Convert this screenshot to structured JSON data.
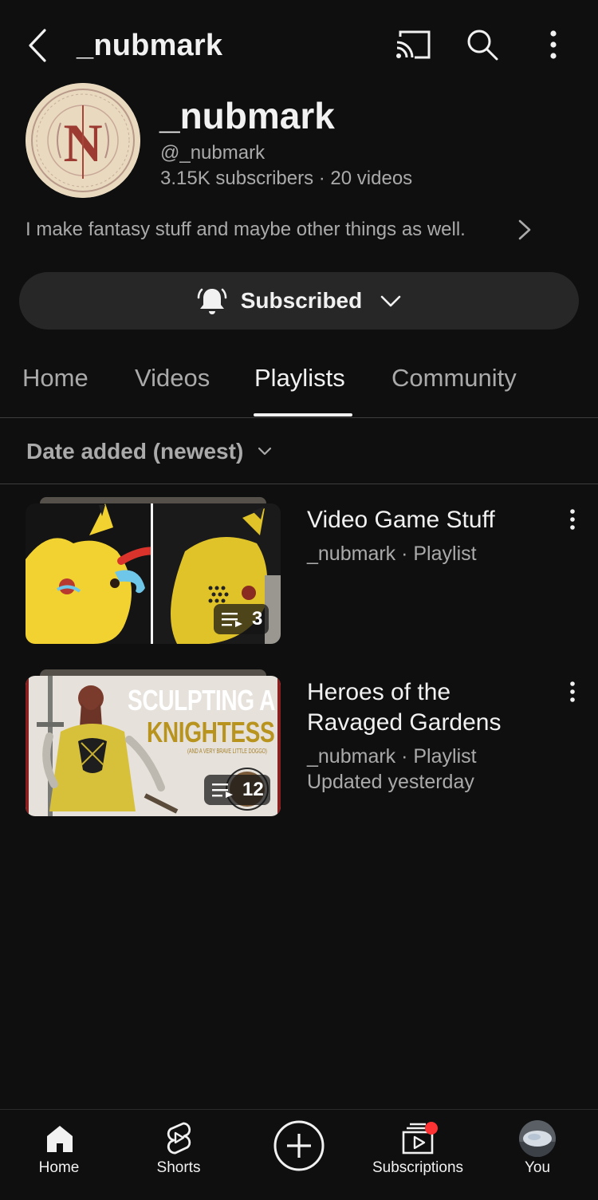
{
  "header": {
    "title": "_nubmark"
  },
  "channel": {
    "name": "_nubmark",
    "handle": "@_nubmark",
    "stats": "3.15K subscribers  ·  20 videos",
    "description": "I make fantasy stuff and maybe other things as well.",
    "subscribe_label": "Subscribed"
  },
  "tabs": [
    {
      "label": "Home",
      "active": false
    },
    {
      "label": "Videos",
      "active": false
    },
    {
      "label": "Playlists",
      "active": true
    },
    {
      "label": "Community",
      "active": false
    }
  ],
  "sort": {
    "label": "Date added (newest)"
  },
  "playlists": [
    {
      "title": "Video Game Stuff",
      "meta": "_nubmark · Playlist",
      "updated": "",
      "count": "3"
    },
    {
      "title": "Heroes of the Ravaged Gardens",
      "meta": "_nubmark · Playlist",
      "updated": "Updated yesterday",
      "count": "12",
      "thumb_text_1": "SCULPTING A",
      "thumb_text_2": "KNIGHTESS",
      "thumb_text_3": "(AND A VERY BRAVE LITTLE DOGGO)"
    }
  ],
  "bottom_nav": {
    "home": "Home",
    "shorts": "Shorts",
    "subscriptions": "Subscriptions",
    "you": "You"
  },
  "colors": {
    "background": "#0f0f0f",
    "surface": "#272727",
    "text_primary": "#f1f1f1",
    "text_secondary": "#aaaaaa",
    "notification_dot": "#ff3333"
  }
}
